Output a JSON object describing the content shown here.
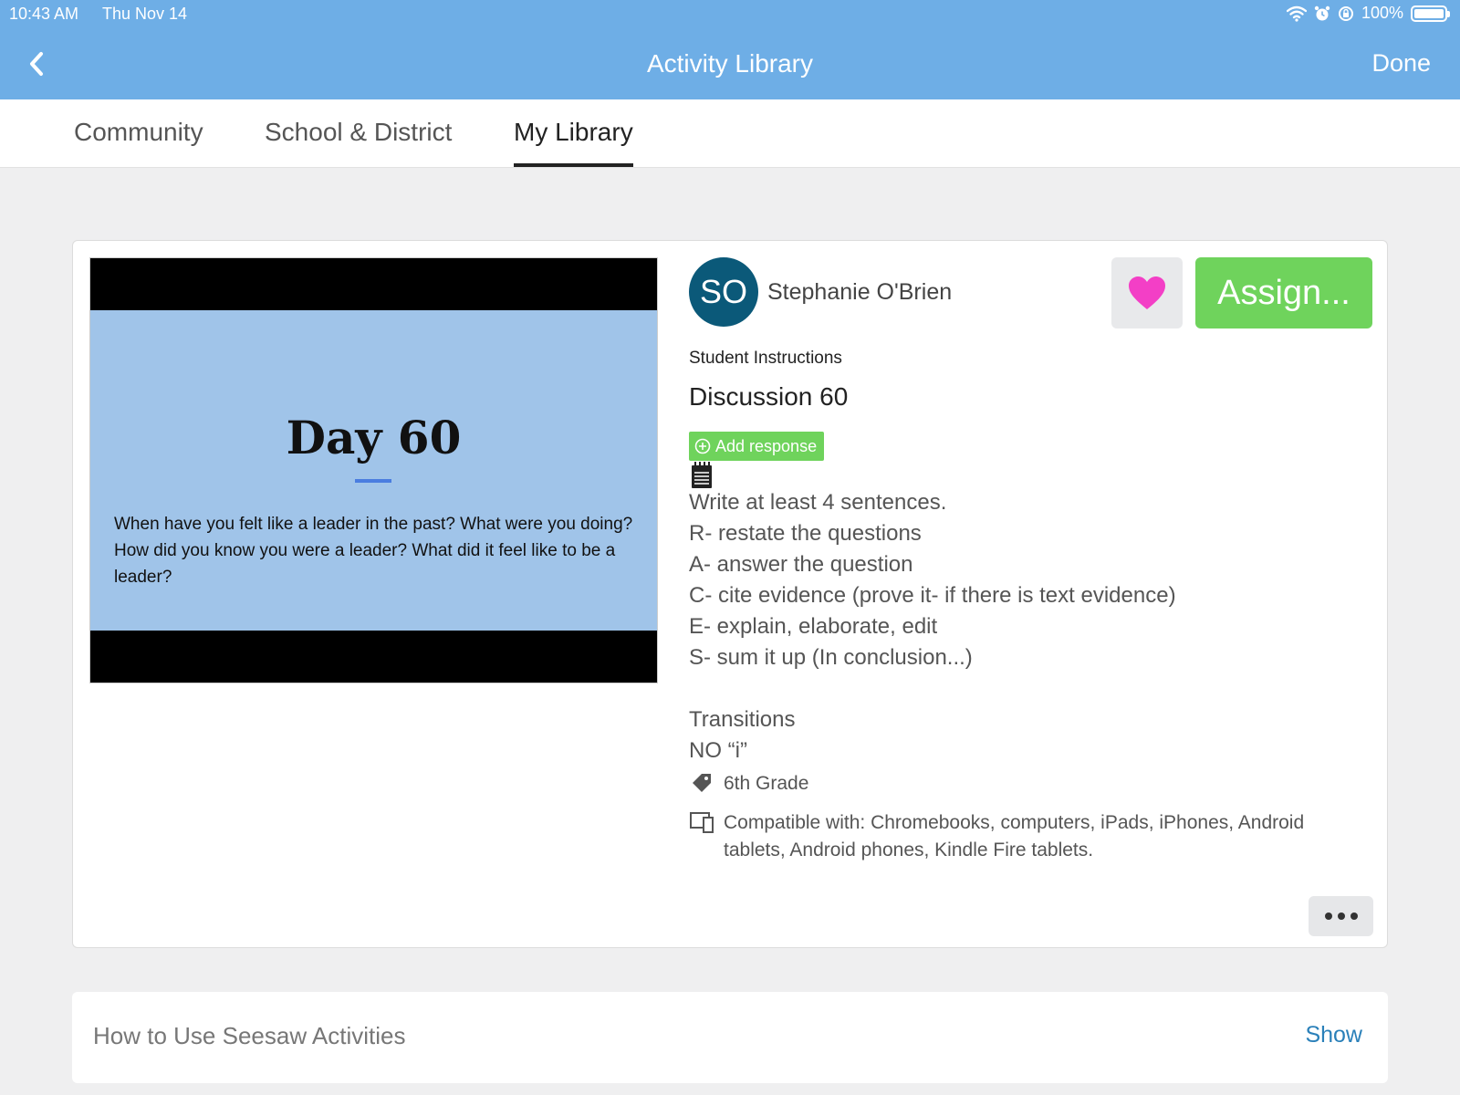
{
  "status_bar": {
    "time": "10:43 AM",
    "date": "Thu Nov 14",
    "battery": "100%"
  },
  "header": {
    "title": "Activity Library",
    "done_label": "Done"
  },
  "tabs": [
    {
      "label": "Community"
    },
    {
      "label": "School & District"
    },
    {
      "label": "My Library",
      "active": true
    }
  ],
  "activity": {
    "preview": {
      "title": "Day 60",
      "text": "When have you felt like a leader in the past? What were you doing? How did you know you were a leader? What did it feel like to be a leader?"
    },
    "author": {
      "initials": "SO",
      "name": "Stephanie O'Brien"
    },
    "assign_label": "Assign...",
    "section_label": "Student Instructions",
    "title": "Discussion 60",
    "add_response_label": "Add response",
    "instructions": [
      "Write at least 4 sentences.",
      "R- restate the questions",
      "A- answer the question",
      "C- cite evidence (prove it- if there is text evidence)",
      "E- explain, elaborate, edit",
      "S- sum it up (In conclusion...)",
      "",
      "Transitions",
      "NO “i”"
    ],
    "grade": "6th Grade",
    "compatibility": "Compatible with: Chromebooks, computers, iPads, iPhones, Android tablets, Android phones, Kindle Fire tablets."
  },
  "help_panel": {
    "title": "How to Use Seesaw Activities",
    "show_label": "Show"
  },
  "colors": {
    "header": "#6eaee6",
    "assign": "#6fd35c",
    "heart": "#f33fc6",
    "avatar": "#0b5979",
    "link": "#2a80b9"
  }
}
